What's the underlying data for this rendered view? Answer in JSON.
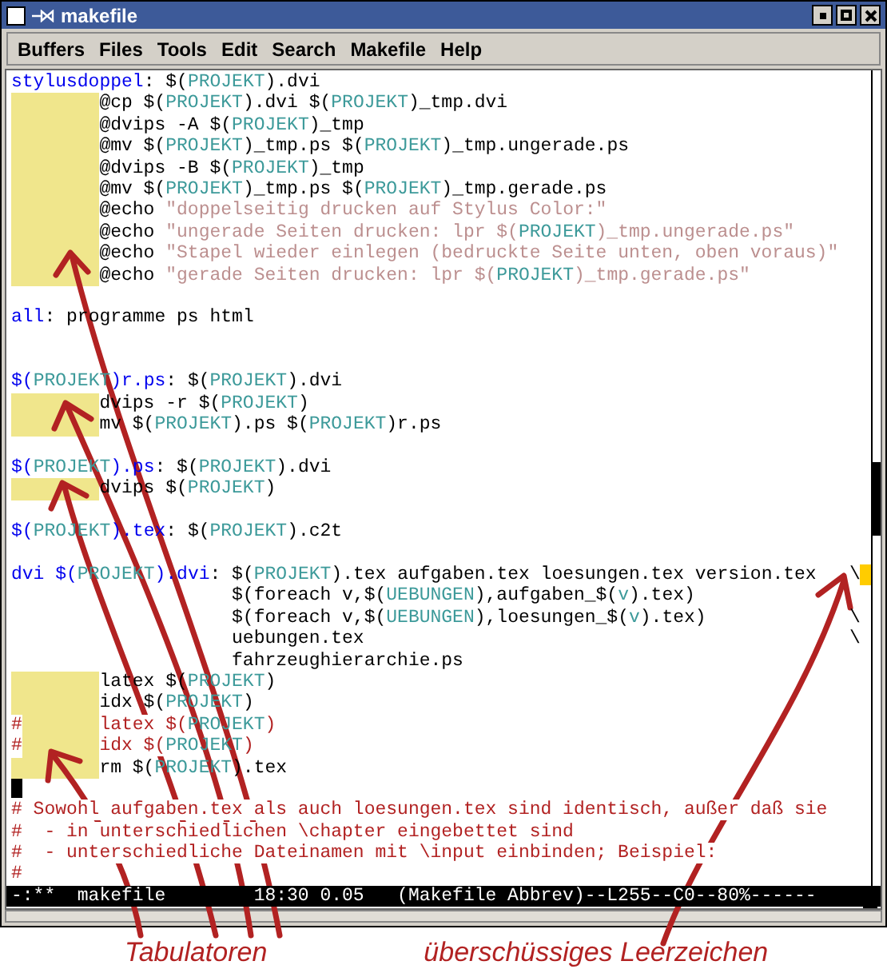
{
  "window": {
    "title": "makefile"
  },
  "menu": [
    "Buffers",
    "Files",
    "Tools",
    "Edit",
    "Search",
    "Makefile",
    "Help"
  ],
  "lines": [
    {
      "kind": "code",
      "segments": [
        {
          "kind": "tgt",
          "t": "stylusdoppel"
        },
        {
          "kind": "p",
          "t": ": $("
        },
        {
          "kind": "var",
          "t": "PROJEKT"
        },
        {
          "kind": "p",
          "t": ").dvi"
        }
      ]
    },
    {
      "kind": "code",
      "segments": [
        {
          "kind": "tab"
        },
        {
          "kind": "p",
          "t": "@cp $("
        },
        {
          "kind": "var",
          "t": "PROJEKT"
        },
        {
          "kind": "p",
          "t": ").dvi $("
        },
        {
          "kind": "var",
          "t": "PROJEKT"
        },
        {
          "kind": "p",
          "t": ")_tmp.dvi"
        }
      ]
    },
    {
      "kind": "code",
      "segments": [
        {
          "kind": "tab"
        },
        {
          "kind": "p",
          "t": "@dvips -A $("
        },
        {
          "kind": "var",
          "t": "PROJEKT"
        },
        {
          "kind": "p",
          "t": ")_tmp"
        }
      ]
    },
    {
      "kind": "code",
      "segments": [
        {
          "kind": "tab"
        },
        {
          "kind": "p",
          "t": "@mv $("
        },
        {
          "kind": "var",
          "t": "PROJEKT"
        },
        {
          "kind": "p",
          "t": ")_tmp.ps $("
        },
        {
          "kind": "var",
          "t": "PROJEKT"
        },
        {
          "kind": "p",
          "t": ")_tmp.ungerade.ps"
        }
      ]
    },
    {
      "kind": "code",
      "segments": [
        {
          "kind": "tab"
        },
        {
          "kind": "p",
          "t": "@dvips -B $("
        },
        {
          "kind": "var",
          "t": "PROJEKT"
        },
        {
          "kind": "p",
          "t": ")_tmp"
        }
      ]
    },
    {
      "kind": "code",
      "segments": [
        {
          "kind": "tab"
        },
        {
          "kind": "p",
          "t": "@mv $("
        },
        {
          "kind": "var",
          "t": "PROJEKT"
        },
        {
          "kind": "p",
          "t": ")_tmp.ps $("
        },
        {
          "kind": "var",
          "t": "PROJEKT"
        },
        {
          "kind": "p",
          "t": ")_tmp.gerade.ps"
        }
      ]
    },
    {
      "kind": "code",
      "segments": [
        {
          "kind": "tab"
        },
        {
          "kind": "p",
          "t": "@echo "
        },
        {
          "kind": "str",
          "t": "\"doppelseitig drucken auf Stylus Color:\""
        }
      ]
    },
    {
      "kind": "code",
      "segments": [
        {
          "kind": "tab"
        },
        {
          "kind": "p",
          "t": "@echo "
        },
        {
          "kind": "str",
          "t": "\"ungerade Seiten drucken: lpr $("
        },
        {
          "kind": "var",
          "t": "PROJEKT"
        },
        {
          "kind": "str",
          "t": ")_tmp.ungerade.ps\""
        }
      ]
    },
    {
      "kind": "code",
      "segments": [
        {
          "kind": "tab"
        },
        {
          "kind": "p",
          "t": "@echo "
        },
        {
          "kind": "str",
          "t": "\"Stapel wieder einlegen (bedruckte Seite unten, oben voraus)\""
        }
      ]
    },
    {
      "kind": "code",
      "segments": [
        {
          "kind": "tab"
        },
        {
          "kind": "p",
          "t": "@echo "
        },
        {
          "kind": "str",
          "t": "\"gerade Seiten drucken: lpr $("
        },
        {
          "kind": "var",
          "t": "PROJEKT"
        },
        {
          "kind": "str",
          "t": ")_tmp.gerade.ps\""
        }
      ]
    },
    {
      "kind": "blank"
    },
    {
      "kind": "code",
      "segments": [
        {
          "kind": "tgt",
          "t": "all"
        },
        {
          "kind": "p",
          "t": ": programme ps html"
        }
      ]
    },
    {
      "kind": "blank"
    },
    {
      "kind": "blank"
    },
    {
      "kind": "code",
      "segments": [
        {
          "kind": "tgt",
          "t": "$("
        },
        {
          "kind": "var",
          "t": "PROJEKT"
        },
        {
          "kind": "tgt",
          "t": ")r.ps"
        },
        {
          "kind": "p",
          "t": ": $("
        },
        {
          "kind": "var",
          "t": "PROJEKT"
        },
        {
          "kind": "p",
          "t": ").dvi"
        }
      ]
    },
    {
      "kind": "code",
      "segments": [
        {
          "kind": "tab"
        },
        {
          "kind": "p",
          "t": "dvips -r $("
        },
        {
          "kind": "var",
          "t": "PROJEKT"
        },
        {
          "kind": "p",
          "t": ")"
        }
      ]
    },
    {
      "kind": "code",
      "segments": [
        {
          "kind": "tab"
        },
        {
          "kind": "p",
          "t": "mv $("
        },
        {
          "kind": "var",
          "t": "PROJEKT"
        },
        {
          "kind": "p",
          "t": ").ps $("
        },
        {
          "kind": "var",
          "t": "PROJEKT"
        },
        {
          "kind": "p",
          "t": ")r.ps"
        }
      ]
    },
    {
      "kind": "blank"
    },
    {
      "kind": "code",
      "segments": [
        {
          "kind": "tgt",
          "t": "$("
        },
        {
          "kind": "var",
          "t": "PROJEKT"
        },
        {
          "kind": "tgt",
          "t": ").ps"
        },
        {
          "kind": "p",
          "t": ": $("
        },
        {
          "kind": "var",
          "t": "PROJEKT"
        },
        {
          "kind": "p",
          "t": ").dvi"
        }
      ]
    },
    {
      "kind": "code",
      "segments": [
        {
          "kind": "tab"
        },
        {
          "kind": "p",
          "t": "dvips $("
        },
        {
          "kind": "var",
          "t": "PROJEKT"
        },
        {
          "kind": "p",
          "t": ")"
        }
      ]
    },
    {
      "kind": "blank"
    },
    {
      "kind": "code",
      "segments": [
        {
          "kind": "tgt",
          "t": "$("
        },
        {
          "kind": "var",
          "t": "PROJEKT"
        },
        {
          "kind": "tgt",
          "t": ").tex"
        },
        {
          "kind": "p",
          "t": ": $("
        },
        {
          "kind": "var",
          "t": "PROJEKT"
        },
        {
          "kind": "p",
          "t": ").c2t"
        }
      ]
    },
    {
      "kind": "blank"
    },
    {
      "kind": "code",
      "segments": [
        {
          "kind": "tgt",
          "t": "dvi $("
        },
        {
          "kind": "var",
          "t": "PROJEKT"
        },
        {
          "kind": "tgt",
          "t": ").dvi"
        },
        {
          "kind": "p",
          "t": ": $("
        },
        {
          "kind": "var",
          "t": "PROJEKT"
        },
        {
          "kind": "p",
          "t": ").tex aufgaben.tex loesungen.tex version.tex   \\"
        },
        {
          "kind": "ws"
        }
      ]
    },
    {
      "kind": "code",
      "segments": [
        {
          "kind": "p",
          "t": "                    $(foreach v,$("
        },
        {
          "kind": "var",
          "t": "UEBUNGEN"
        },
        {
          "kind": "p",
          "t": "),aufgaben_$("
        },
        {
          "kind": "var",
          "t": "v"
        },
        {
          "kind": "p",
          "t": ").tex)"
        }
      ]
    },
    {
      "kind": "code",
      "segments": [
        {
          "kind": "p",
          "t": "                    $(foreach v,$("
        },
        {
          "kind": "var",
          "t": "UEBUNGEN"
        },
        {
          "kind": "p",
          "t": "),loesungen_$("
        },
        {
          "kind": "var",
          "t": "v"
        },
        {
          "kind": "p",
          "t": ").tex)             \\"
        }
      ]
    },
    {
      "kind": "code",
      "segments": [
        {
          "kind": "p",
          "t": "                    uebungen.tex                                            \\"
        }
      ]
    },
    {
      "kind": "code",
      "segments": [
        {
          "kind": "p",
          "t": "                    fahrzeughierarchie.ps"
        }
      ]
    },
    {
      "kind": "code",
      "segments": [
        {
          "kind": "tab"
        },
        {
          "kind": "p",
          "t": "latex $("
        },
        {
          "kind": "var",
          "t": "PROJEKT"
        },
        {
          "kind": "p",
          "t": ")"
        }
      ]
    },
    {
      "kind": "code",
      "segments": [
        {
          "kind": "tab"
        },
        {
          "kind": "p",
          "t": "idx $("
        },
        {
          "kind": "var",
          "t": "PROJEKT"
        },
        {
          "kind": "p",
          "t": ")"
        }
      ]
    },
    {
      "kind": "code",
      "segments": [
        {
          "kind": "com",
          "t": "#"
        },
        {
          "kind": "tab"
        },
        {
          "kind": "com",
          "t": "latex $("
        },
        {
          "kind": "var",
          "t": "PROJEKT"
        },
        {
          "kind": "com",
          "t": ")"
        }
      ]
    },
    {
      "kind": "code",
      "segments": [
        {
          "kind": "com",
          "t": "#"
        },
        {
          "kind": "tab"
        },
        {
          "kind": "com",
          "t": "idx $("
        },
        {
          "kind": "var",
          "t": "PROJEKT"
        },
        {
          "kind": "com",
          "t": ")"
        }
      ]
    },
    {
      "kind": "code",
      "segments": [
        {
          "kind": "tab"
        },
        {
          "kind": "p",
          "t": "rm $("
        },
        {
          "kind": "var",
          "t": "PROJEKT"
        },
        {
          "kind": "p",
          "t": ").tex"
        }
      ]
    },
    {
      "kind": "cursor"
    },
    {
      "kind": "code",
      "segments": [
        {
          "kind": "com",
          "t": "# Sowohl aufgaben.tex als auch loesungen.tex sind identisch, außer daß sie"
        }
      ]
    },
    {
      "kind": "code",
      "segments": [
        {
          "kind": "com",
          "t": "#  - in unterschiedlichen \\chapter eingebettet sind"
        }
      ]
    },
    {
      "kind": "code",
      "segments": [
        {
          "kind": "com",
          "t": "#  - unterschiedliche Dateinamen mit \\input einbinden; Beispiel:"
        }
      ]
    },
    {
      "kind": "code",
      "segments": [
        {
          "kind": "com",
          "t": "#"
        }
      ]
    }
  ],
  "mode_line": "-:**  makefile        18:30 0.05   (Makefile Abbrev)--L255--C0--80%------",
  "annotations": [
    {
      "label": "Tabulatoren"
    },
    {
      "label": "überschüssiges Leerzeichen"
    }
  ]
}
